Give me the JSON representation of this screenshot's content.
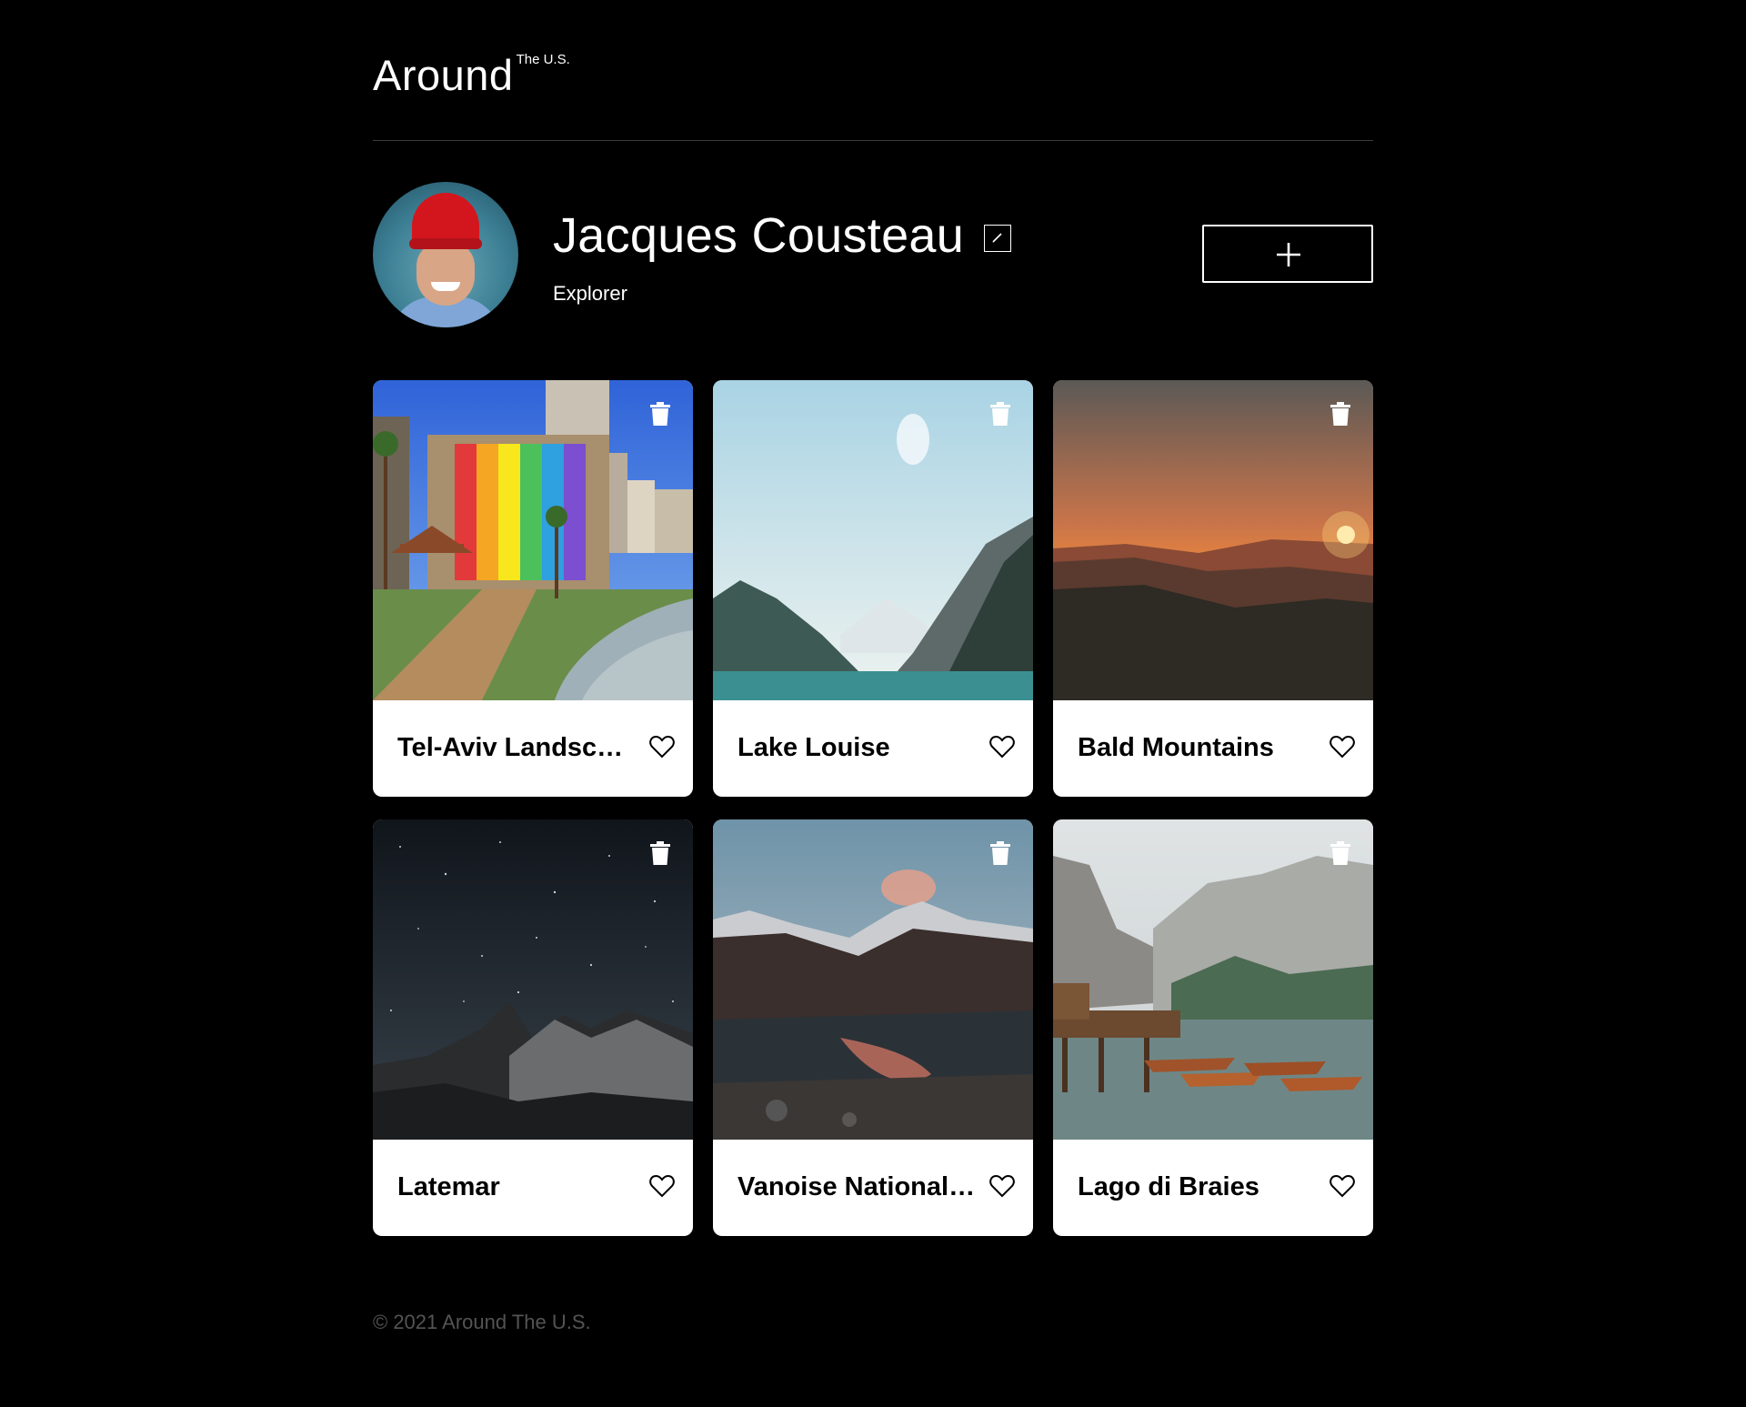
{
  "header": {
    "logo_main": "Around",
    "logo_sup": "The U.S."
  },
  "profile": {
    "name": "Jacques Cousteau",
    "job": "Explorer"
  },
  "cards": [
    {
      "title": "Tel-Aviv Landscape"
    },
    {
      "title": "Lake Louise"
    },
    {
      "title": "Bald Mountains"
    },
    {
      "title": "Latemar"
    },
    {
      "title": "Vanoise National Park"
    },
    {
      "title": "Lago di Braies"
    }
  ],
  "footer": {
    "copyright": "© 2021 Around The U.S."
  },
  "colors": {
    "background": "#000000",
    "card": "#ffffff",
    "footer_text": "#545454",
    "divider": "#545454"
  }
}
